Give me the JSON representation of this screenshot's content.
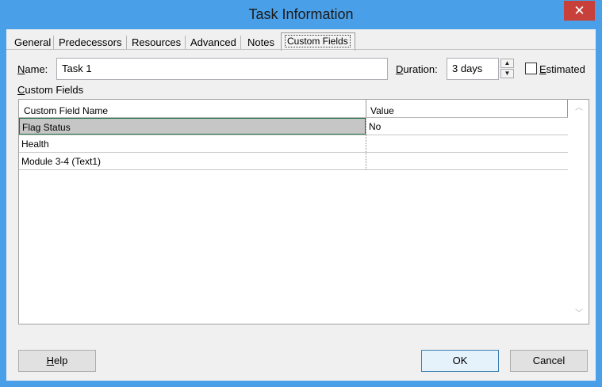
{
  "window": {
    "title": "Task Information",
    "close_glyph": "✕"
  },
  "tabs": [
    {
      "label": "General"
    },
    {
      "label": "Predecessors"
    },
    {
      "label": "Resources"
    },
    {
      "label": "Advanced"
    },
    {
      "label": "Notes"
    },
    {
      "label": "Custom Fields",
      "active": true
    }
  ],
  "form": {
    "name_label_ul": "N",
    "name_label_rest": "ame:",
    "name_value": "Task 1",
    "duration_label_ul": "D",
    "duration_label_rest": "uration:",
    "duration_value": "3 days",
    "estimated_label_ul": "E",
    "estimated_label_rest": "stimated",
    "estimated_checked": false
  },
  "custom_fields": {
    "section_label_ul": "C",
    "section_label_rest": "ustom Fields",
    "columns": [
      "Custom Field Name",
      "Value"
    ],
    "rows": [
      {
        "name": "Flag Status",
        "value": "No"
      },
      {
        "name": "Health",
        "value": ""
      },
      {
        "name": "Module 3-4 (Text1)",
        "value": ""
      }
    ]
  },
  "buttons": {
    "help_ul": "H",
    "help_rest": "elp",
    "ok": "OK",
    "cancel": "Cancel"
  },
  "icons": {
    "spin_up": "spin-up-arrow-icon",
    "spin_down": "spin-down-arrow-icon",
    "scroll_up": "scroll-up-arrow-icon",
    "scroll_down": "scroll-down-arrow-icon"
  }
}
